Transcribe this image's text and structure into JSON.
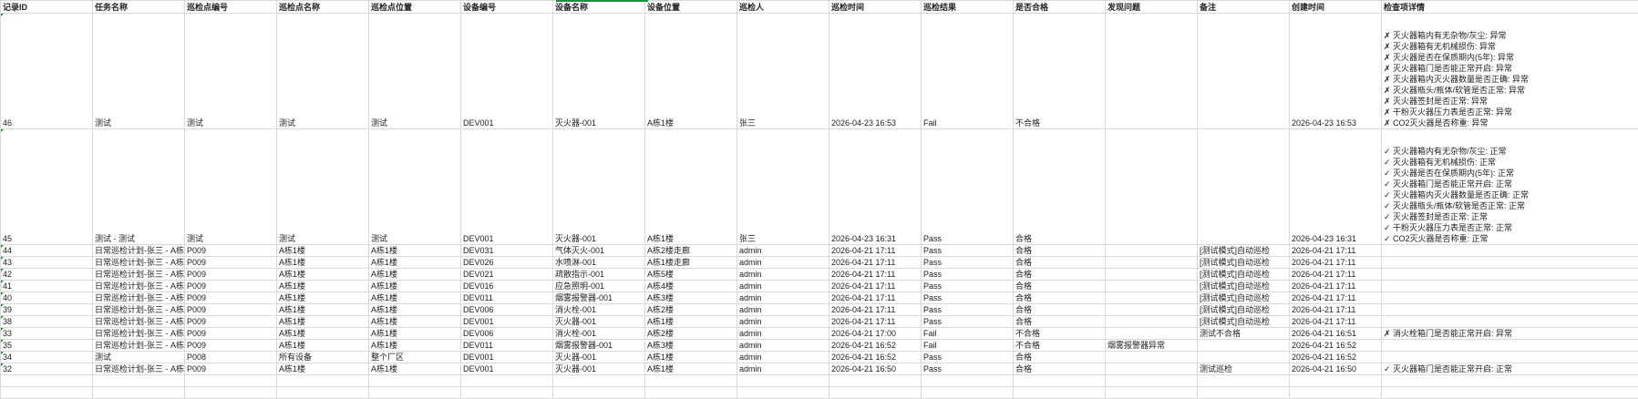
{
  "headers": [
    "记录ID",
    "任务名称",
    "巡检点编号",
    "巡检点名称",
    "巡检点位置",
    "设备编号",
    "设备名称",
    "设备位置",
    "巡检人",
    "巡检时间",
    "巡检结果",
    "是否合格",
    "发现问题",
    "备注",
    "创建时间",
    "检查项详情"
  ],
  "rows": [
    [
      "46",
      "测试",
      "测试",
      "测试",
      "测试",
      "DEV001",
      "灭火器-001",
      "A栋1楼",
      "张三",
      "2026-04-23 16:53",
      "Fail",
      "不合格",
      "",
      "",
      "2026-04-23 16:53",
      "✗ 灭火器箱内有无杂物/灰尘: 异常\n✗ 灭火器箱有无机械损伤: 异常\n✗ 灭火器是否在保质期内(5年): 异常\n✗ 灭火器箱门是否能正常开启: 异常\n✗ 灭火器箱内灭火器数量是否正确: 异常\n✗ 灭火器瓶头/瓶体/软管是否正常: 异常\n✗ 灭火器签封是否正常: 异常\n✗ 干粉灭火器压力表是否正常: 异常\n✗ CO2灭火器是否称重: 异常"
    ],
    [
      "45",
      "测试 - 测试",
      "测试",
      "测试",
      "测试",
      "DEV001",
      "灭火器-001",
      "A栋1楼",
      "张三",
      "2026-04-23 16:31",
      "Pass",
      "合格",
      "",
      "",
      "2026-04-23 16:31",
      "✓ 灭火器箱内有无杂物/灰尘: 正常\n✓ 灭火器箱有无机械损伤: 正常\n✓ 灭火器是否在保质期内(5年): 正常\n✓ 灭火器箱门是否能正常开启: 正常\n✓ 灭火器箱内灭火器数量是否正确: 正常\n✓ 灭火器瓶头/瓶体/软管是否正常: 正常\n✓ 灭火器签封是否正常: 正常\n✓ 干粉灭火器压力表是否正常: 正常\n✓ CO2灭火器是否称重: 正常"
    ],
    [
      "44",
      "日常巡检计划-张三 - A栋",
      "P009",
      "A栋1楼",
      "A栋1楼",
      "DEV031",
      "气体灭火-001",
      "A栋2楼走廊",
      "admin",
      "2026-04-21 17:11",
      "Pass",
      "合格",
      "",
      "[测试模式]自动巡检",
      "2026-04-21 17:11",
      ""
    ],
    [
      "43",
      "日常巡检计划-张三 - A栋",
      "P009",
      "A栋1楼",
      "A栋1楼",
      "DEV026",
      "水喷淋-001",
      "A栋1楼走廊",
      "admin",
      "2026-04-21 17:11",
      "Pass",
      "合格",
      "",
      "[测试模式]自动巡检",
      "2026-04-21 17:11",
      ""
    ],
    [
      "42",
      "日常巡检计划-张三 - A栋",
      "P009",
      "A栋1楼",
      "A栋1楼",
      "DEV021",
      "疏散指示-001",
      "A栋5楼",
      "admin",
      "2026-04-21 17:11",
      "Pass",
      "合格",
      "",
      "[测试模式]自动巡检",
      "2026-04-21 17:11",
      ""
    ],
    [
      "41",
      "日常巡检计划-张三 - A栋",
      "P009",
      "A栋1楼",
      "A栋1楼",
      "DEV016",
      "应急照明-001",
      "A栋4楼",
      "admin",
      "2026-04-21 17:11",
      "Pass",
      "合格",
      "",
      "[测试模式]自动巡检",
      "2026-04-21 17:11",
      ""
    ],
    [
      "40",
      "日常巡检计划-张三 - A栋",
      "P009",
      "A栋1楼",
      "A栋1楼",
      "DEV011",
      "烟雾报警器-001",
      "A栋3楼",
      "admin",
      "2026-04-21 17:11",
      "Pass",
      "合格",
      "",
      "[测试模式]自动巡检",
      "2026-04-21 17:11",
      ""
    ],
    [
      "39",
      "日常巡检计划-张三 - A栋",
      "P009",
      "A栋1楼",
      "A栋1楼",
      "DEV006",
      "消火栓-001",
      "A栋2楼",
      "admin",
      "2026-04-21 17:11",
      "Pass",
      "合格",
      "",
      "[测试模式]自动巡检",
      "2026-04-21 17:11",
      ""
    ],
    [
      "38",
      "日常巡检计划-张三 - A栋",
      "P009",
      "A栋1楼",
      "A栋1楼",
      "DEV001",
      "灭火器-001",
      "A栋1楼",
      "admin",
      "2026-04-21 17:11",
      "Pass",
      "合格",
      "",
      "[测试模式]自动巡检",
      "2026-04-21 17:11",
      ""
    ],
    [
      "33",
      "日常巡检计划-张三 - A栋",
      "P009",
      "A栋1楼",
      "A栋1楼",
      "DEV006",
      "消火栓-001",
      "A栋2楼",
      "admin",
      "2026-04-21 17:00",
      "Fail",
      "不合格",
      "",
      "测试不合格",
      "2026-04-21 16:51",
      "✗ 消火栓箱门是否能正常开启: 异常"
    ],
    [
      "35",
      "日常巡检计划-张三 - A栋",
      "P009",
      "A栋1楼",
      "A栋1楼",
      "DEV011",
      "烟雾报警器-001",
      "A栋3楼",
      "admin",
      "2026-04-21 16:52",
      "Fail",
      "不合格",
      "烟雾报警器异常",
      "",
      "2026-04-21 16:52",
      ""
    ],
    [
      "34",
      "测试",
      "P008",
      "所有设备",
      "整个厂区",
      "DEV001",
      "灭火器-001",
      "A栋1楼",
      "admin",
      "2026-04-21 16:52",
      "Pass",
      "合格",
      "",
      "",
      "2026-04-21 16:52",
      ""
    ],
    [
      "32",
      "日常巡检计划-张三 - A栋",
      "P009",
      "A栋1楼",
      "A栋1楼",
      "DEV001",
      "灭火器-001",
      "A栋1楼",
      "admin",
      "2026-04-21 16:50",
      "Pass",
      "合格",
      "",
      "测试巡检",
      "2026-04-21 16:50",
      "✓ 灭火器箱门是否能正常开启: 正常"
    ]
  ]
}
